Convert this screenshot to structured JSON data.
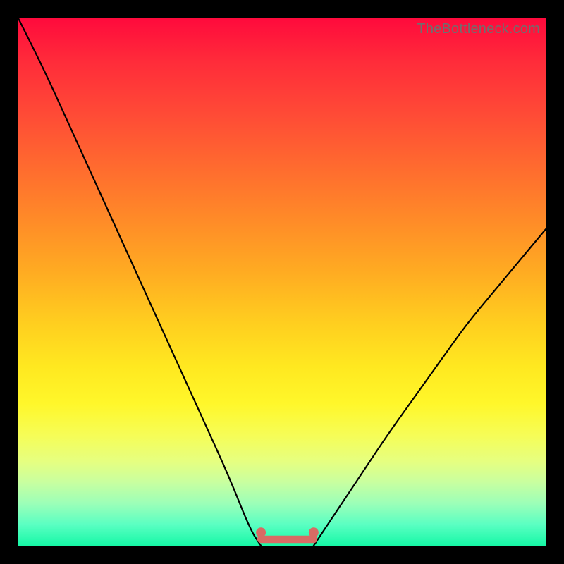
{
  "watermark": "TheBottleneck.com",
  "chart_data": {
    "type": "line",
    "title": "",
    "xlabel": "",
    "ylabel": "",
    "xlim": [
      0,
      100
    ],
    "ylim": [
      0,
      100
    ],
    "series": [
      {
        "name": "left-branch",
        "x": [
          0,
          5,
          10,
          15,
          20,
          25,
          30,
          35,
          40,
          44,
          46
        ],
        "values": [
          100,
          90,
          79,
          68,
          57,
          46,
          35,
          24,
          13,
          3,
          0
        ]
      },
      {
        "name": "right-branch",
        "x": [
          56,
          58,
          62,
          66,
          70,
          75,
          80,
          85,
          90,
          95,
          100
        ],
        "values": [
          0,
          3,
          9,
          15,
          21,
          28,
          35,
          42,
          48,
          54,
          60
        ]
      },
      {
        "name": "flat-bottom",
        "x": [
          46,
          48,
          50,
          52,
          54,
          56
        ],
        "values": [
          0,
          0,
          0,
          0,
          0,
          0
        ]
      }
    ],
    "markers": {
      "name": "bottom-dots",
      "color": "#d86b64",
      "points": [
        {
          "x": 46,
          "y": 2.5
        },
        {
          "x": 56,
          "y": 2.5
        }
      ]
    },
    "bottom_band": {
      "color": "#d86b64",
      "x_start": 46,
      "x_end": 56,
      "y": 1.2,
      "thickness_pct": 1.4
    },
    "gradient_stops": [
      {
        "pct": 0,
        "color": "#ff0a3c"
      },
      {
        "pct": 8,
        "color": "#ff2b3a"
      },
      {
        "pct": 18,
        "color": "#ff4a36"
      },
      {
        "pct": 28,
        "color": "#ff6a2f"
      },
      {
        "pct": 38,
        "color": "#ff8a28"
      },
      {
        "pct": 48,
        "color": "#ffab22"
      },
      {
        "pct": 58,
        "color": "#ffcf1f"
      },
      {
        "pct": 66,
        "color": "#ffe820"
      },
      {
        "pct": 73,
        "color": "#fff72a"
      },
      {
        "pct": 79,
        "color": "#f6fd56"
      },
      {
        "pct": 84,
        "color": "#e6ff80"
      },
      {
        "pct": 88,
        "color": "#c8ffa0"
      },
      {
        "pct": 92,
        "color": "#9cffb8"
      },
      {
        "pct": 96,
        "color": "#5affc2"
      },
      {
        "pct": 100,
        "color": "#16f8a6"
      }
    ]
  }
}
